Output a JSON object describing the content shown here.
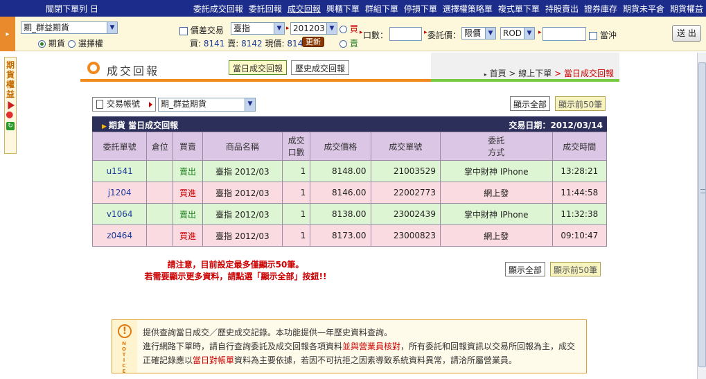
{
  "topbar": {
    "close_list": "關閉下單列 日",
    "nav": [
      "委託成交回報",
      "委託回報",
      "成交回報",
      "興櫃下單",
      "群組下單",
      "停損下單",
      "選擇權策略單",
      "複式單下單",
      "持股賣出",
      "證券庫存",
      "期貨未平倉",
      "期貨權益"
    ],
    "active_index": 2
  },
  "orderbar": {
    "account": "期_群益期貨",
    "futures_label": "期貨",
    "options_label": "選擇權",
    "spread_label": "價差交易",
    "product": "臺指",
    "month": "201203",
    "buy_label": "買",
    "sell_label": "賣",
    "quote_prefix_buy": "買:",
    "quote_buy": "8141",
    "quote_prefix_sell": "賣:",
    "quote_sell": "8142",
    "quote_prefix_last": "現價:",
    "quote_last": "8142",
    "refresh_label": "更新",
    "qty_label": "口數：",
    "price_label": "委託價：",
    "price_type": "限價",
    "tif": "ROD",
    "daytrade_label": "當沖",
    "submit_label": "送 出"
  },
  "side": {
    "text": "期貨權益"
  },
  "header": {
    "title": "成交回報",
    "tab_today": "當日成交回報",
    "tab_history": "歷史成交回報",
    "crumb_home": "首頁",
    "crumb_sep1": " > ",
    "crumb_mid": "線上下單",
    "crumb_sep2": " > ",
    "crumb_current": "當日成交回報"
  },
  "account_row": {
    "label": "交易帳號",
    "value": "期_群益期貨",
    "show_all": "顯示全部",
    "show_50": "顯示前50筆"
  },
  "table": {
    "caption": "期貨 當日成交回報",
    "date_label": "交易日期：",
    "date": "2012/03/14",
    "columns": [
      "委託單號",
      "倉位",
      "買賣",
      "商品名稱",
      "成交口數",
      "成交價格",
      "成交單號",
      "委託方式",
      "成交時間"
    ],
    "column_line2": [
      "",
      "",
      "",
      "",
      "口數",
      "",
      "",
      "方式",
      ""
    ],
    "column_line1": [
      "委託單號",
      "倉位",
      "買賣",
      "商品名稱",
      "成交",
      "成交價格",
      "成交單號",
      "委託",
      "成交時間"
    ],
    "rows": [
      {
        "order": "u1541",
        "position": "",
        "side": "賣出",
        "product": "臺指 2012/03",
        "qty": "1",
        "price": "8148.00",
        "trade_no": "21003529",
        "method": "掌中財神 IPhone",
        "time": "13:28:21"
      },
      {
        "order": "j1204",
        "position": "",
        "side": "買進",
        "product": "臺指 2012/03",
        "qty": "1",
        "price": "8146.00",
        "trade_no": "22002773",
        "method": "網上發",
        "time": "11:44:58"
      },
      {
        "order": "v1064",
        "position": "",
        "side": "賣出",
        "product": "臺指 2012/03",
        "qty": "1",
        "price": "8138.00",
        "trade_no": "23002439",
        "method": "掌中財神 IPhone",
        "time": "11:32:38"
      },
      {
        "order": "z0464",
        "position": "",
        "side": "買進",
        "product": "臺指 2012/03",
        "qty": "1",
        "price": "8173.00",
        "trade_no": "23000823",
        "method": "網上發",
        "time": "09:10:47"
      }
    ]
  },
  "warning": {
    "line1": "請注意，目前設定最多僅顯示50筆。",
    "line2": "若需要顯示更多資料，請點選「顯示全部」按鈕!!"
  },
  "notice": {
    "badge": "NOTICE",
    "line1": "提供查詢當日成交／歷史成交記錄。本功能提供一年歷史資料查詢。",
    "line2_a": "進行網路下單時，請自行查詢委託及成交回報各項資料",
    "line2_em": "並與營業員核對",
    "line2_b": "，所有委託和回報資訊以交易所回報為主，成交",
    "line3_a": "正確記錄應以",
    "line3_em": "當日對帳單",
    "line3_b": "資料為主要依據，若因不可抗拒之因素導致系統資料異常，請洽所屬營業員。"
  },
  "colors": {
    "nav_bg": "#1b2c8a",
    "accent_orange": "#f08a1c",
    "accent_green": "#7ac943",
    "row_green": "#ddf5d2",
    "row_pink": "#fbdbe2",
    "header_purple": "#dcc6e6"
  }
}
